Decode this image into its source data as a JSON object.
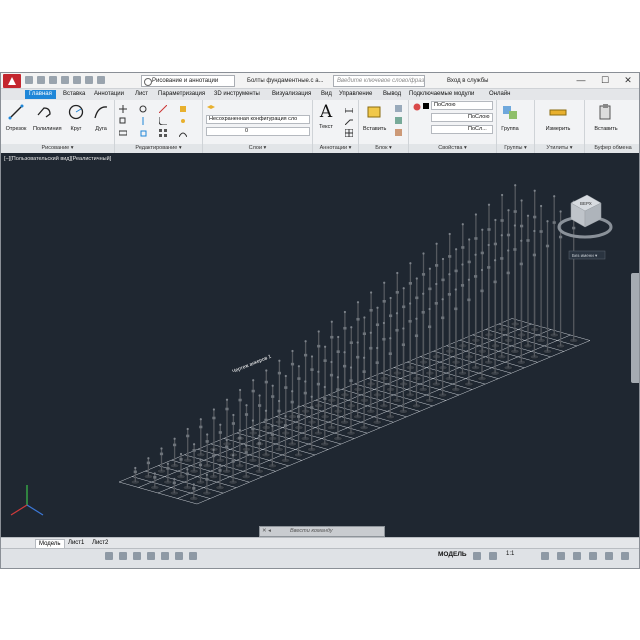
{
  "titlebar": {
    "workspace": "Рисование и аннотации",
    "document": "Болты фундаментные.с а...",
    "search_placeholder": "Введите ключевое слово/фразу",
    "signin": "Вход в службы",
    "minimize": "—",
    "maximize": "☐",
    "close": "✕"
  },
  "tabs": [
    "Главная",
    "Вставка",
    "Аннотации",
    "Лист",
    "Параметризация",
    "3D инструменты",
    "Визуализация",
    "Вид",
    "Управление",
    "Вывод",
    "Подключаемые модули",
    "Онлайн"
  ],
  "ribbon": {
    "draw": {
      "title": "Рисование ▾",
      "line": "Отрезок",
      "polyline": "Полилиния",
      "circle": "Круг",
      "arc": "Дуга"
    },
    "modify": {
      "title": "Редактирование ▾"
    },
    "layers": {
      "title": "Слои ▾",
      "state": "Несохраненная конфигурация сло",
      "layer": "0"
    },
    "annotation": {
      "title": "Аннотации ▾",
      "text": "Текст"
    },
    "block": {
      "title": "Блок ▾",
      "insert": "Вставить"
    },
    "properties": {
      "title": "Свойства ▾",
      "color": "ПоСлою",
      "linetype": "ПоСлою",
      "lineweight": "ПоСл..."
    },
    "groups": {
      "title": "Группы ▾",
      "group": "Группа"
    },
    "utilities": {
      "title": "Утилиты ▾",
      "measure": "Измерить"
    },
    "clipboard": {
      "title": "Буфер обмена",
      "paste": "Вставить"
    }
  },
  "viewport": {
    "label": "[−][Пользовательский вид][Реалистичный]",
    "annotation": "Чертеж анкеров 1",
    "viewcube_face": "ВЕРХ",
    "viewcube_mode": "Без имени ▾",
    "command_placeholder": "Ввести команду"
  },
  "layout_tabs": [
    "Модель",
    "Лист1",
    "Лист2"
  ],
  "status": {
    "model": "МОДЕЛЬ",
    "scale": "1:1"
  },
  "chart_data": {
    "type": "grid-3d",
    "rows": 4,
    "columns": 30
  }
}
